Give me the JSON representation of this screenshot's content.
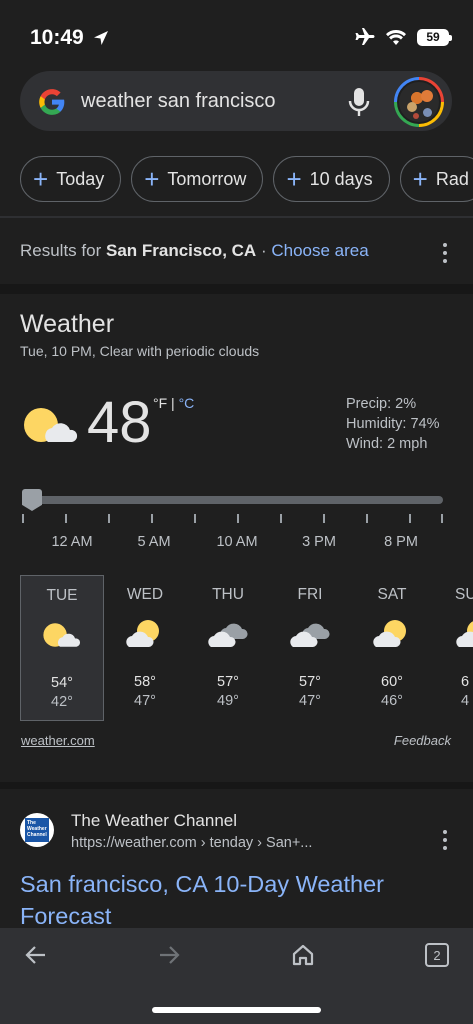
{
  "status_bar": {
    "time": "10:49",
    "battery": "59"
  },
  "search": {
    "query": "weather san francisco"
  },
  "chips": [
    "Today",
    "Tomorrow",
    "10 days",
    "Rad"
  ],
  "results_for": {
    "prefix": "Results for",
    "location": "San Francisco, CA",
    "separator": "·",
    "choose_area": "Choose area"
  },
  "weather": {
    "title": "Weather",
    "subtitle": "Tue, 10 PM, Clear with periodic clouds",
    "temperature": "48",
    "unit_f": "°F",
    "unit_sep": "|",
    "unit_c": "°C",
    "precip": "Precip: 2%",
    "humidity": "Humidity: 74%",
    "wind": "Wind: 2 mph",
    "time_labels": [
      "12 AM",
      "5 AM",
      "10 AM",
      "3 PM",
      "8 PM"
    ],
    "days": [
      {
        "name": "TUE",
        "hi": "54°",
        "lo": "42°",
        "icon": "partly-cloudy-night-icon"
      },
      {
        "name": "WED",
        "hi": "58°",
        "lo": "47°",
        "icon": "partly-cloudy-icon"
      },
      {
        "name": "THU",
        "hi": "57°",
        "lo": "49°",
        "icon": "cloudy-icon"
      },
      {
        "name": "FRI",
        "hi": "57°",
        "lo": "47°",
        "icon": "cloudy-icon"
      },
      {
        "name": "SAT",
        "hi": "60°",
        "lo": "46°",
        "icon": "partly-cloudy-icon"
      },
      {
        "name": "SU",
        "hi": "6",
        "lo": "4",
        "icon": "partly-cloudy-icon"
      }
    ],
    "source": "weather.com",
    "feedback": "Feedback"
  },
  "result": {
    "favicon_text": "The Weather Channel",
    "site_name": "The Weather Channel",
    "url": "https://weather.com › tenday › San+...",
    "title": "San francisco, CA 10-Day Weather Forecast"
  },
  "toolbar": {
    "tab_count": "2"
  },
  "colors": {
    "accent": "#8ab4f8",
    "background": "#1f1f1f",
    "surface": "#303134",
    "sun": "#fdd663"
  }
}
